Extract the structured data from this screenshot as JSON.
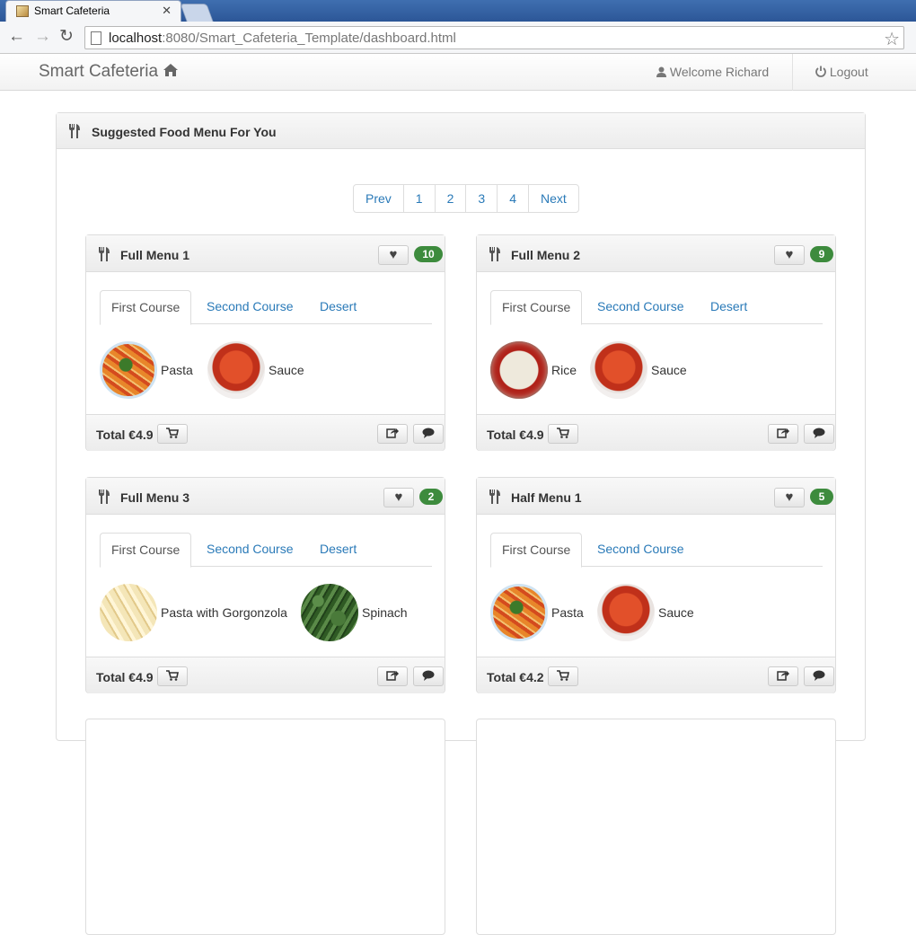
{
  "browser": {
    "tab_title": "Smart Cafeteria",
    "url_host": "localhost",
    "url_rest": ":8080/Smart_Cafeteria_Template/dashboard.html"
  },
  "navbar": {
    "brand": "Smart Cafeteria",
    "welcome": "Welcome Richard",
    "logout": "Logout"
  },
  "panel": {
    "title": "Suggested Food Menu For You"
  },
  "pagination": [
    "Prev",
    "1",
    "2",
    "3",
    "4",
    "Next"
  ],
  "cards": [
    {
      "title": "Full Menu 1",
      "likes": "10",
      "tabs": [
        "First Course",
        "Second Course",
        "Desert"
      ],
      "foods": [
        {
          "name": "Pasta",
          "img": "pasta"
        },
        {
          "name": "Sauce",
          "img": "sauce"
        }
      ],
      "total": "Total €4.9"
    },
    {
      "title": "Full Menu 2",
      "likes": "9",
      "tabs": [
        "First Course",
        "Second Course",
        "Desert"
      ],
      "foods": [
        {
          "name": "Rice",
          "img": "rice"
        },
        {
          "name": "Sauce",
          "img": "sauce"
        }
      ],
      "total": "Total €4.9"
    },
    {
      "title": "Full Menu 3",
      "likes": "2",
      "tabs": [
        "First Course",
        "Second Course",
        "Desert"
      ],
      "foods": [
        {
          "name": "Pasta with Gorgonzola",
          "img": "gorg"
        },
        {
          "name": "Spinach",
          "img": "spinach"
        }
      ],
      "total": "Total €4.9"
    },
    {
      "title": "Half Menu 1",
      "likes": "5",
      "tabs": [
        "First Course",
        "Second Course"
      ],
      "foods": [
        {
          "name": "Pasta",
          "img": "pasta"
        },
        {
          "name": "Sauce",
          "img": "sauce"
        }
      ],
      "total": "Total €4.2"
    }
  ],
  "colors": {
    "link": "#2a7ab8",
    "badge": "#3d8b3d"
  }
}
